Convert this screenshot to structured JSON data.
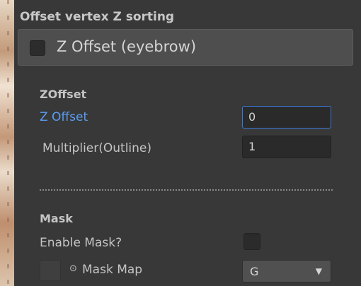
{
  "section": {
    "title": "Offset vertex Z sorting",
    "header_toggle_label": "Z Offset (eyebrow)"
  },
  "zoffset_group": {
    "title": "ZOffset",
    "z_offset": {
      "label": "Z Offset",
      "value": "0"
    },
    "multiplier": {
      "label": "Multiplier(Outline)",
      "value": "1"
    }
  },
  "mask_group": {
    "title": "Mask",
    "enable_mask_label": "Enable Mask?",
    "mask_map": {
      "picker_icon": "⊙",
      "label": "Mask Map",
      "channel": "G",
      "arrow": "▼"
    }
  },
  "colors": {
    "panel_bg": "#383838",
    "field_focus": "#3a79d9",
    "active_label": "#5a9cf0"
  }
}
